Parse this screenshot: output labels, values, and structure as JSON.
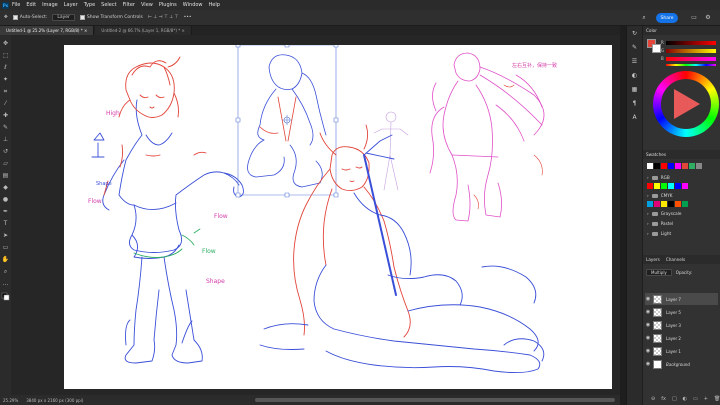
{
  "menubar": {
    "logo": "Ps",
    "items": [
      "File",
      "Edit",
      "Image",
      "Layer",
      "Type",
      "Select",
      "Filter",
      "View",
      "Plugins",
      "Window",
      "Help"
    ]
  },
  "options": {
    "auto_select_label": "Auto-Select:",
    "auto_select_value": "Layer",
    "transform_label": "Show Transform Controls",
    "share_label": "Share"
  },
  "tabs": [
    {
      "label": "Untitled-1 @ 25.2% (Layer 7, RGB/8) *",
      "active": true
    },
    {
      "label": "Untitled-2 @ 66.7% (Layer 1, RGB/8*) *",
      "active": false
    }
  ],
  "status": {
    "zoom": "25.29%",
    "doc_info": "3840 px x 2160 px (300 ppi)"
  },
  "canvas_annotations": {
    "high": "High",
    "shape": "Shape",
    "flow1": "Flow",
    "flow2": "Flow",
    "flow3": "Flow",
    "shape2": "Shape",
    "cjk": "左右互补，保持一致"
  },
  "color_panel": {
    "tab": "Color",
    "rows": [
      "R",
      "G",
      "B"
    ]
  },
  "swatches_panel": {
    "tab": "Swatches",
    "folders": [
      "RGB",
      "CMYK",
      "Grayscale",
      "Pastel",
      "Light"
    ],
    "colors": [
      "#ffffff",
      "#000000",
      "#ff0000",
      "#ffff00",
      "#00ff00",
      "#00ffff",
      "#0000ff",
      "#ff00ff",
      "#ff8000"
    ]
  },
  "layers_panel": {
    "tabs": [
      "Layers",
      "Channels"
    ],
    "blend_mode": "Multiply",
    "opacity_label": "Opacity:",
    "layers": [
      {
        "name": "Layer 7",
        "active": true
      },
      {
        "name": "Layer 5",
        "active": false
      },
      {
        "name": "Layer 3",
        "active": false
      },
      {
        "name": "Layer 2",
        "active": false
      },
      {
        "name": "Layer 1",
        "active": false
      },
      {
        "name": "Background",
        "active": false
      }
    ],
    "bottom_icons": [
      "fx",
      "□",
      "◐",
      "▭",
      "+",
      "🗑"
    ]
  }
}
